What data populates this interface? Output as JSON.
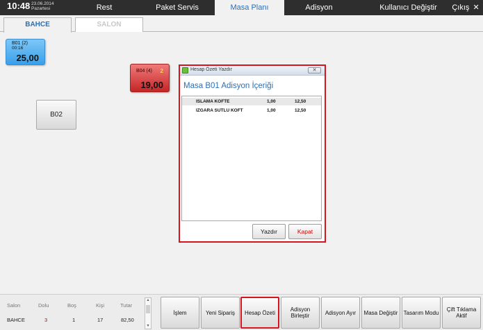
{
  "header": {
    "time": "10:48",
    "date": "23.06.2014",
    "day": "Pazartesi",
    "nav": [
      "Rest",
      "Paket Servis",
      "Masa Planı",
      "Adisyon"
    ],
    "active_nav": "Masa Planı",
    "switch_user": "Kullanıcı Değiştir",
    "exit": "Çıkış",
    "exit_icon": "close-icon"
  },
  "tabs": [
    "BAHCE",
    "SALON"
  ],
  "active_tab": "BAHCE",
  "tables": {
    "b01": {
      "name": "B01 (2)",
      "time": "00:16",
      "amount": "25,00",
      "color": "#3aa0ea"
    },
    "b04": {
      "name": "B04 (4)",
      "badge": "2",
      "amount": "19,00",
      "color": "#c52626"
    },
    "b02": {
      "name": "B02"
    }
  },
  "dialog": {
    "title": "Hesap Özeti Yazdır",
    "heading": "Masa B01 Adisyon İçeriği",
    "items": [
      {
        "name": "ISLAMA KOFTE",
        "qty": "1,00",
        "price": "12,50"
      },
      {
        "name": "IZGARA SUTLU KOFT",
        "qty": "1,00",
        "price": "12,50"
      }
    ],
    "print_label": "Yazdır",
    "close_label": "Kapat",
    "close_color": "#cc0000"
  },
  "stats": {
    "headers": [
      "Salon",
      "Dolu",
      "Boş",
      "Kişi",
      "Tutar"
    ],
    "values": [
      "BAHCE",
      "3",
      "1",
      "17",
      "82,50"
    ]
  },
  "actions": [
    "İşlem",
    "Yeni Sipariş",
    "Hesap Özeti",
    "Adisyon Birleştir",
    "Adisyon Ayır",
    "Masa Değiştir",
    "Tasarım Modu",
    "Çift Tıklama Aktif"
  ]
}
